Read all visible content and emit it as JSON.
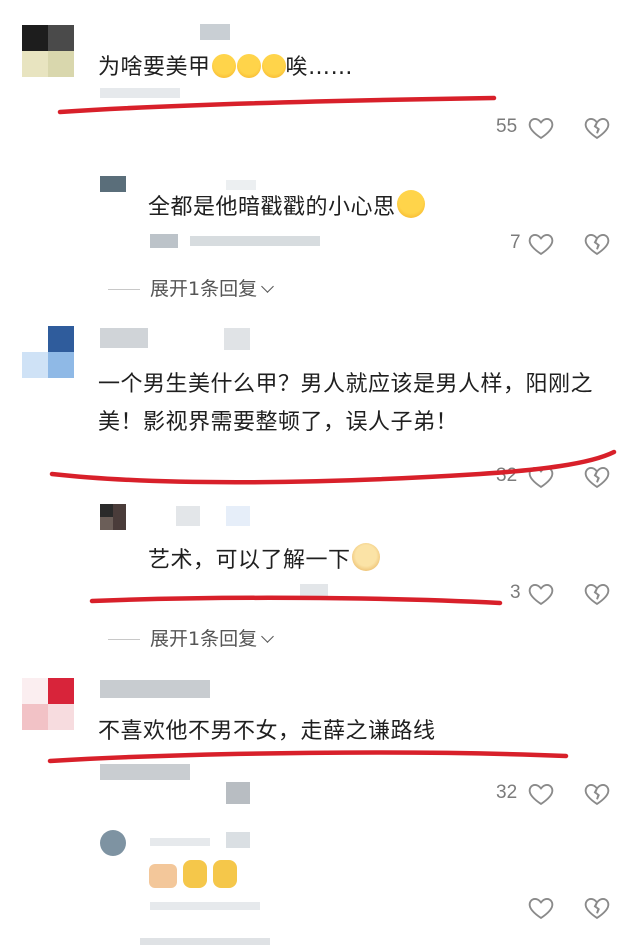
{
  "comments": [
    {
      "text": "为啥要美甲",
      "text_suffix": "唉……",
      "likes": "55",
      "replies": [
        {
          "text": "全都是他暗戳戳的小心思",
          "likes": "7"
        }
      ],
      "expand_label": "展开1条回复"
    },
    {
      "text": "一个男生美什么甲？男人就应该是男人样，阳刚之美！影视界需要整顿了，误人子弟！",
      "likes": "32",
      "replies": [
        {
          "text": "艺术，可以了解一下",
          "likes": "3"
        }
      ],
      "expand_label": "展开1条回复"
    },
    {
      "text": "不喜欢他不男不女，走薛之谦路线",
      "likes": "32",
      "replies": [
        {
          "text": "",
          "likes": ""
        }
      ],
      "expand_label": ""
    }
  ],
  "colors": {
    "annotation_red": "#d8202a",
    "count_gray": "#7b7b7b",
    "icon_gray": "#8a8a8a"
  },
  "icons": {
    "like": "heart-icon",
    "dislike": "broken-heart-icon",
    "expand": "chevron-down-icon"
  }
}
